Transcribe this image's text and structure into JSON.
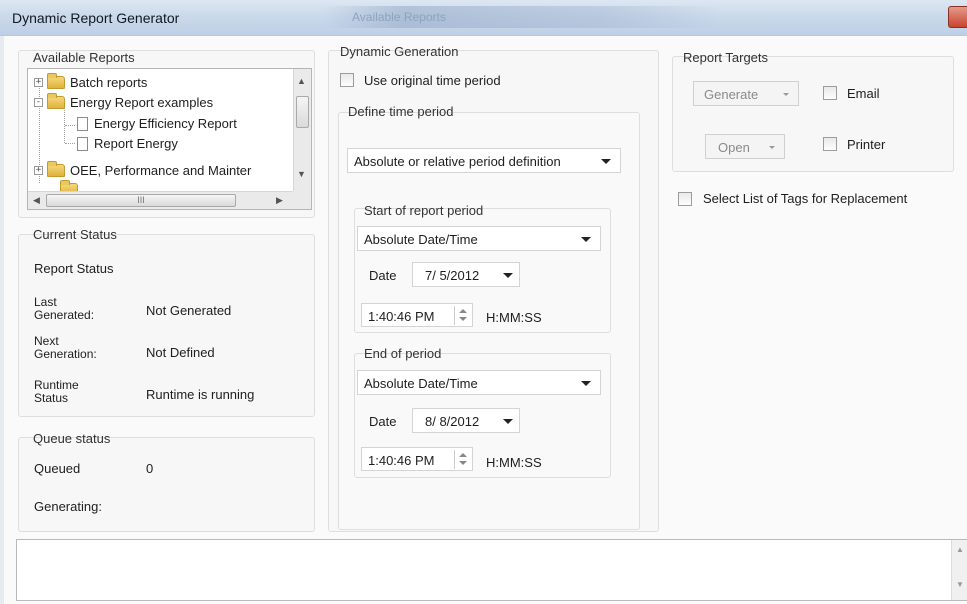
{
  "window": {
    "title": "Dynamic Report Generator",
    "ghost_tab": "Available Reports"
  },
  "available_reports": {
    "label": "Available Reports",
    "tree": [
      {
        "label": "Batch reports",
        "expander": "+"
      },
      {
        "label": "Energy Report examples",
        "expander": "-"
      },
      {
        "label": "Energy Efficiency Report"
      },
      {
        "label": "Report Energy"
      },
      {
        "label": "OEE, Performance and Mainter",
        "expander": "+"
      }
    ],
    "hscroll_grip": "III"
  },
  "current_status": {
    "label": "Current Status",
    "report_status_label": "Report Status",
    "rows": [
      {
        "label": "Last Generated:",
        "value": "Not Generated"
      },
      {
        "label": "Next Generation:",
        "value": "Not Defined"
      },
      {
        "label": "Runtime Status",
        "value": "Runtime is running"
      }
    ]
  },
  "queue_status": {
    "label": "Queue status",
    "queued_label": "Queued",
    "queued_value": "0",
    "generating_label": "Generating:"
  },
  "dynamic_generation": {
    "label": "Dynamic Generation",
    "use_original_label": "Use original time period",
    "define_label": "Define time period",
    "period_mode": "Absolute or relative period definition",
    "start": {
      "label": "Start of report period",
      "type": "Absolute Date/Time",
      "date_label": "Date",
      "date": "7/ 5/2012",
      "time": "1:40:46 PM",
      "time_format": "H:MM:SS"
    },
    "end": {
      "label": "End of period",
      "type": "Absolute Date/Time",
      "date_label": "Date",
      "date": "8/ 8/2012",
      "time": "1:40:46 PM",
      "time_format": "H:MM:SS"
    }
  },
  "report_targets": {
    "label": "Report Targets",
    "generate_label": "Generate",
    "open_label": "Open",
    "email_label": "Email",
    "printer_label": "Printer"
  },
  "select_tags_label": "Select List of Tags for Replacement",
  "colors": {
    "titlebar": "#c9d8ea",
    "close": "#c8452f",
    "folder": "#e0b23c"
  }
}
